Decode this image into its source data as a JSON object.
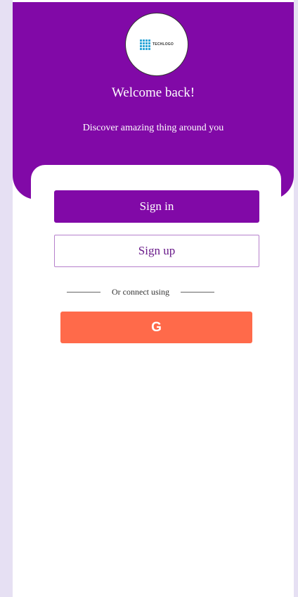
{
  "colors": {
    "primary": "#8109a7",
    "google": "#ff6a4a",
    "background": "#e6e0f3"
  },
  "logo": {
    "text": "TECHLOGO",
    "icon": "grid-logo-icon"
  },
  "header": {
    "title": "Welcome back!",
    "subtitle": "Discover amazing thing around you"
  },
  "actions": {
    "signin_label": "Sign in",
    "signup_label": "Sign up"
  },
  "divider": {
    "label": "Or connect using"
  },
  "social": {
    "google_glyph": "G",
    "google_icon": "google-icon"
  }
}
